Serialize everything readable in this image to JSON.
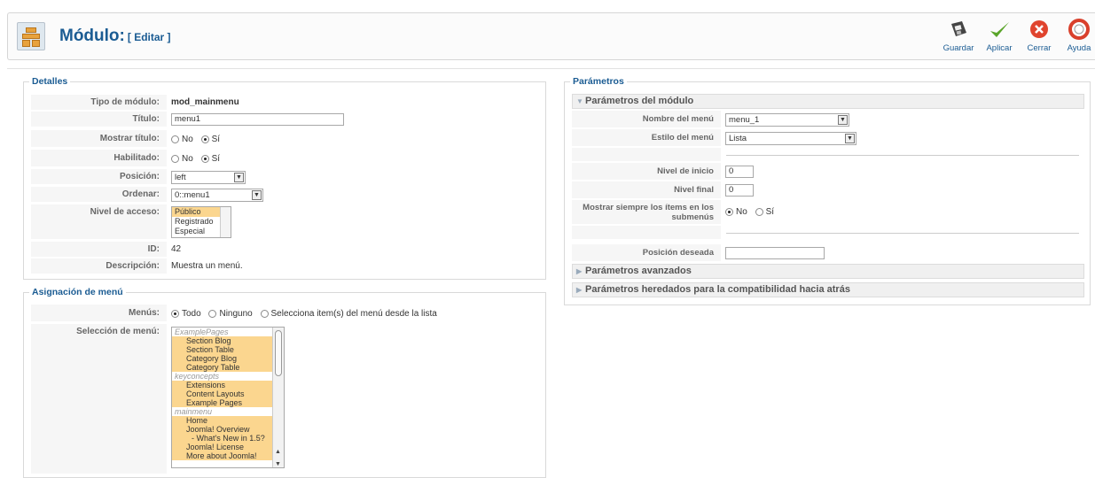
{
  "header": {
    "title": "Módulo:",
    "subtitle": "[ Editar ]",
    "toolbar": {
      "save": "Guardar",
      "apply": "Aplicar",
      "close": "Cerrar",
      "help": "Ayuda"
    }
  },
  "details": {
    "legend": "Detalles",
    "module_type_label": "Tipo de módulo:",
    "module_type_value": "mod_mainmenu",
    "title_label": "Título:",
    "title_value": "menu1",
    "show_title_label": "Mostrar título:",
    "enabled_label": "Habilitado:",
    "no": "No",
    "yes": "Sí",
    "position_label": "Posición:",
    "position_value": "left",
    "order_label": "Ordenar:",
    "order_value": "0::menu1",
    "access_label": "Nivel de acceso:",
    "access_options": [
      "Público",
      "Registrado",
      "Especial"
    ],
    "id_label": "ID:",
    "id_value": "42",
    "description_label": "Descripción:",
    "description_value": "Muestra un menú."
  },
  "menu_assignment": {
    "legend": "Asignación de menú",
    "menus_label": "Menús:",
    "opt_all": "Todo",
    "opt_none": "Ninguno",
    "opt_select": "Selecciona item(s) del menú desde la lista",
    "selection_label": "Selección de menú:",
    "items": [
      {
        "text": "ExamplePages",
        "type": "grp"
      },
      {
        "text": "Section Blog",
        "type": "ind"
      },
      {
        "text": "Section Table",
        "type": "ind"
      },
      {
        "text": "Category Blog",
        "type": "ind"
      },
      {
        "text": "Category Table",
        "type": "ind"
      },
      {
        "text": "keyconcepts",
        "type": "grp"
      },
      {
        "text": "Extensions",
        "type": "ind"
      },
      {
        "text": "Content Layouts",
        "type": "ind"
      },
      {
        "text": "Example Pages",
        "type": "ind"
      },
      {
        "text": "mainmenu",
        "type": "grp"
      },
      {
        "text": "Home",
        "type": "ind"
      },
      {
        "text": "Joomla! Overview",
        "type": "ind"
      },
      {
        "text": "- What's New in 1.5?",
        "type": "ind2"
      },
      {
        "text": "Joomla! License",
        "type": "ind"
      },
      {
        "text": "More about Joomla!",
        "type": "ind"
      }
    ]
  },
  "params": {
    "legend": "Parámetros",
    "module_params": "Parámetros del módulo",
    "menu_name_label": "Nombre del menú",
    "menu_name_value": "menu_1",
    "menu_style_label": "Estilo del menú",
    "menu_style_value": "Lista",
    "start_level_label": "Nivel de inicio",
    "start_level_value": "0",
    "end_level_label": "Nivel final",
    "end_level_value": "0",
    "always_show_label": "Mostrar siempre los ítems en los submenús",
    "no": "No",
    "yes": "Sí",
    "target_position_label": "Posición deseada",
    "target_position_value": "",
    "advanced": "Parámetros avanzados",
    "legacy": "Parámetros heredados para la compatibilidad hacia atrás"
  }
}
